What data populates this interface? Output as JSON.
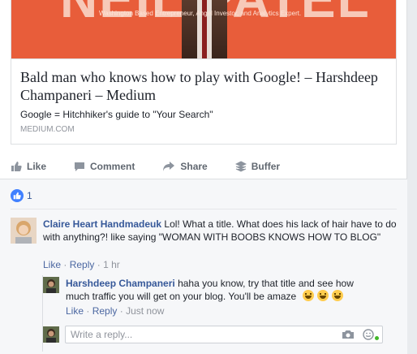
{
  "link_preview": {
    "hero_big_text": "NEIL PATEL",
    "hero_tagline": "Washington Based Entrepreneur, Angel Investor, and Analytics Expert.",
    "title": "Bald man who knows how to play with Google! – Harshdeep Champaneri – Medium",
    "description": "Google = Hitchhiker's guide to \"Your Search\"",
    "domain": "MEDIUM.COM"
  },
  "actions": {
    "like": "Like",
    "comment": "Comment",
    "share": "Share",
    "buffer": "Buffer"
  },
  "reactions": {
    "count": "1",
    "icon": "thumbs-up-icon"
  },
  "comments": [
    {
      "author": "Claire Heart Handmadeuk",
      "text": "Lol! What a title. What does his lack of hair have to do with anything?! like saying \"WOMAN WITH BOOBS KNOWS HOW TO BLOG\"",
      "like": "Like",
      "reply": "Reply",
      "time": "1 hr",
      "separator": "·"
    }
  ],
  "reply": {
    "author": "Harshdeep Champaneri",
    "text": "haha you know, try that title and see how much traffic you will get on your blog. You'll be amaze",
    "like": "Like",
    "reply": "Reply",
    "time": "Just now",
    "separator": "·"
  },
  "reply_box": {
    "placeholder": "Write a reply...",
    "camera_icon": "camera-icon",
    "emoji_icon": "emoji-icon"
  },
  "colors": {
    "link": "#365899",
    "accent": "#4080ff",
    "hero": "#e85d3a",
    "online": "#42b72a"
  }
}
